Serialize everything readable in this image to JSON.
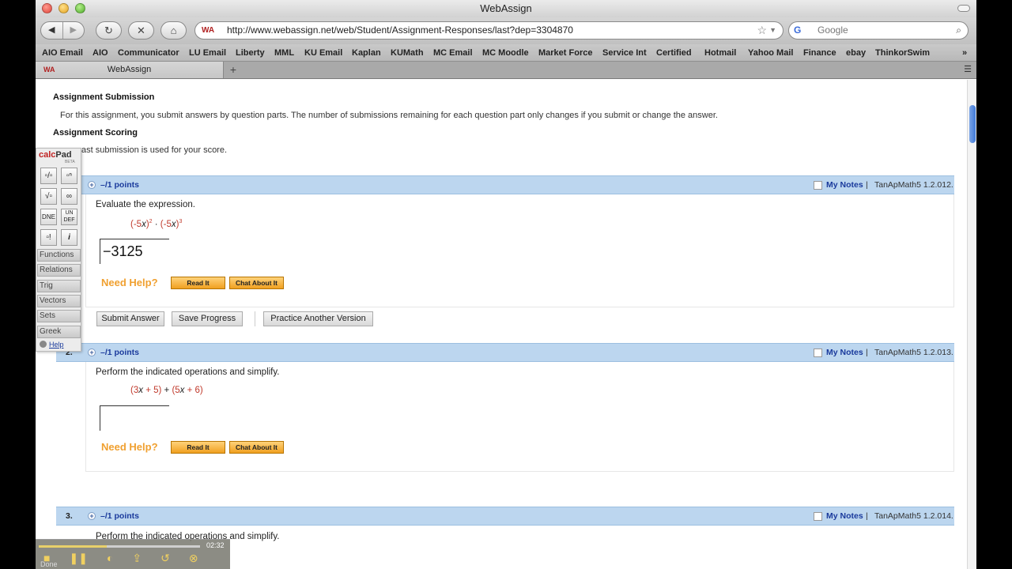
{
  "window": {
    "title": "WebAssign"
  },
  "toolbar": {
    "back_icon": "◀",
    "forward_icon": "▶",
    "reload_icon": "↻",
    "stop_icon": "✕",
    "home_icon": "⌂",
    "url": "http://www.webassign.net/web/Student/Assignment-Responses/last?dep=3304870",
    "search_placeholder": "Google"
  },
  "bookmarks": [
    "AIO Email",
    "AIO",
    "Communicator",
    "LU Email",
    "Liberty",
    "MML",
    "KU Email",
    "Kaplan",
    "KUMath",
    "MC Email",
    "MC Moodle",
    "Market Force",
    "Service Int",
    "Certified",
    "Hotmail",
    "Yahoo Mail",
    "Finance",
    "ebay",
    "ThinkorSwim"
  ],
  "tab": {
    "label": "WebAssign"
  },
  "page": {
    "submission_heading": "Assignment Submission",
    "submission_text": "For this assignment, you submit answers by question parts. The number of submissions remaining for each question part only changes if you submit or change the answer.",
    "scoring_heading": "Assignment Scoring",
    "scoring_text": "ast submission is used for your score."
  },
  "questions": [
    {
      "number": "1.",
      "points": "–/1 points",
      "my_notes": "My Notes",
      "ref": "TanApMath5 1.2.012.",
      "prompt": "Evaluate the expression.",
      "answer": "−3125",
      "need_help": "Need Help?",
      "read_it": "Read It",
      "chat": "Chat About It"
    },
    {
      "number": "2.",
      "points": "–/1 points",
      "my_notes": "My Notes",
      "ref": "TanApMath5 1.2.013.",
      "prompt": "Perform the indicated operations and simplify.",
      "answer": "",
      "need_help": "Need Help?",
      "read_it": "Read It",
      "chat": "Chat About It"
    },
    {
      "number": "3.",
      "points": "–/1 points",
      "my_notes": "My Notes",
      "ref": "TanApMath5 1.2.014.",
      "prompt": "Perform the indicated operations and simplify."
    }
  ],
  "actions": {
    "submit": "Submit Answer",
    "save": "Save Progress",
    "practice": "Practice Another Version"
  },
  "calcpad": {
    "logo_calc": "calc",
    "logo_pad": "Pad",
    "beta": "BETA",
    "keys": [
      "▫/▫",
      "▫ⁿ",
      "√▫",
      "∞",
      "DNE",
      "UN DEF",
      "▫!",
      "i"
    ],
    "categories": [
      "Functions",
      "Relations",
      "Trig",
      "Vectors",
      "Sets",
      "Greek"
    ],
    "help": "Help"
  },
  "media": {
    "time": "02:32",
    "progress": 0.42,
    "status": "Done"
  }
}
